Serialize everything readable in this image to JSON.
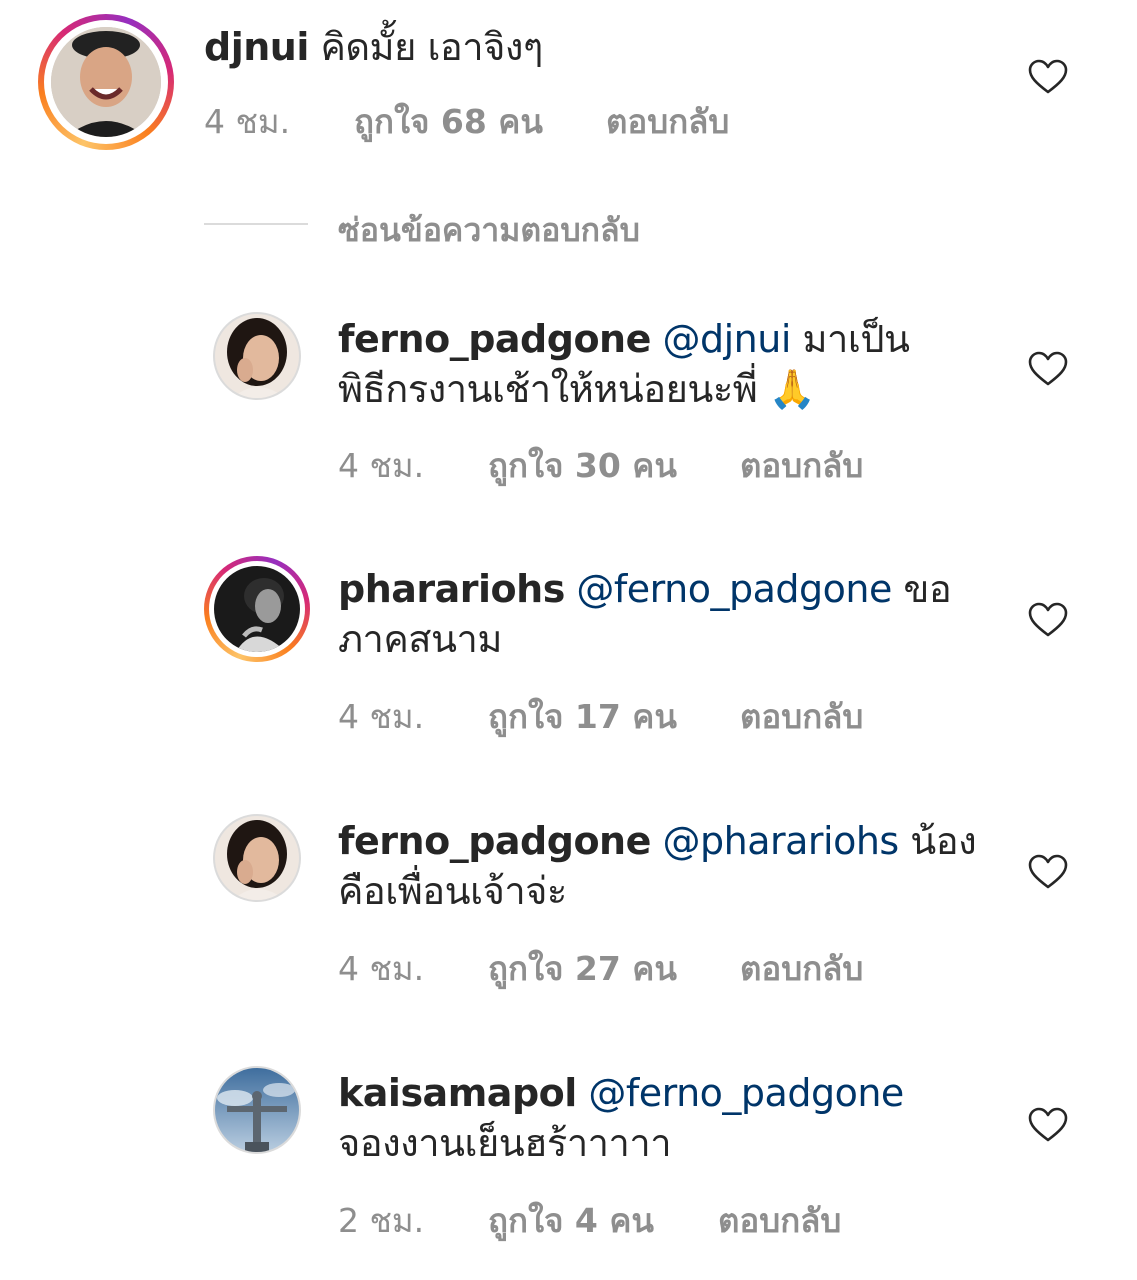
{
  "comments": [
    {
      "username": "djnui",
      "mention": "",
      "text": "คิดมั้ย เอาจิงๆ",
      "text2": "",
      "time": "4 ชม.",
      "likes": "ถูกใจ 68 คน",
      "reply": "ตอบกลับ",
      "story_ring": true
    },
    {
      "username": "ferno_padgone",
      "mention": "@djnui",
      "text": "มาเป็น",
      "text2": "พิธีกรงานเช้าให้หน่อยนะพี่ 🙏",
      "time": "4 ชม.",
      "likes": "ถูกใจ 30 คน",
      "reply": "ตอบกลับ",
      "story_ring": false
    },
    {
      "username": "pharariohs",
      "mention": "@ferno_padgone",
      "text": "ขอ",
      "text2": "ภาคสนาม",
      "time": "4 ชม.",
      "likes": "ถูกใจ 17 คน",
      "reply": "ตอบกลับ",
      "story_ring": true
    },
    {
      "username": "ferno_padgone",
      "mention": "@pharariohs",
      "text": "น้อง",
      "text2": "คือเพื่อนเจ้าจ่ะ",
      "time": "4 ชม.",
      "likes": "ถูกใจ 27 คน",
      "reply": "ตอบกลับ",
      "story_ring": false
    },
    {
      "username": "kaisamapol",
      "mention": "@ferno_padgone",
      "text": "",
      "text2": "จองงานเย็นฮร้าาาาา",
      "time": "2 ชม.",
      "likes": "ถูกใจ 4 คน",
      "reply": "ตอบกลับ",
      "story_ring": false
    }
  ],
  "hide_replies_label": "ซ่อนข้อความตอบกลับ",
  "icons": {
    "like": "heart-outline-icon"
  },
  "colors": {
    "text": "#262626",
    "secondary": "#8e8e8e",
    "mention": "#003569",
    "divider": "#dbdbdb"
  }
}
